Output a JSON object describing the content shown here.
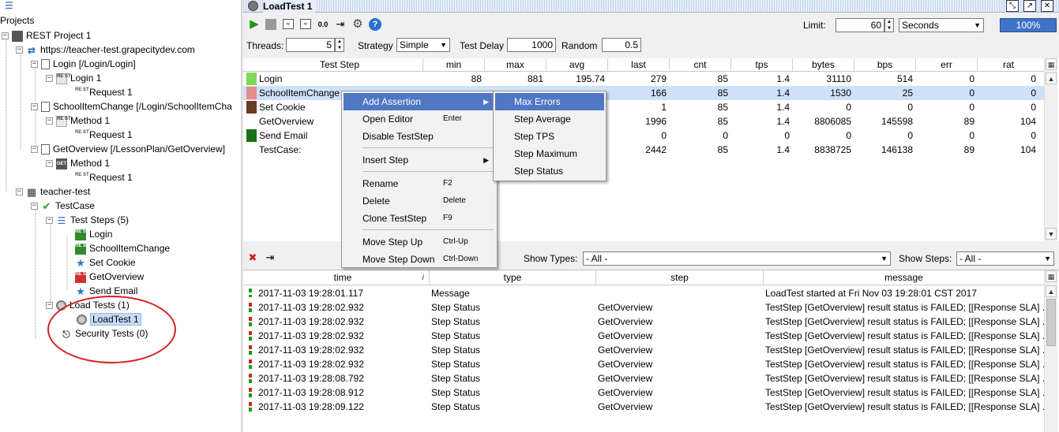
{
  "left": {
    "title": "Projects",
    "nodes": [
      {
        "label": "REST Project 1"
      },
      {
        "label": "https://teacher-test.grapecitydev.com"
      },
      {
        "label": "Login [/Login/Login]"
      },
      {
        "label": "Login 1"
      },
      {
        "label": "Request 1"
      },
      {
        "label": "SchoolItemChange [/Login/SchoolItemCha"
      },
      {
        "label": "Method 1"
      },
      {
        "label": "Request 1"
      },
      {
        "label": "GetOverview [/LessonPlan/GetOverview]"
      },
      {
        "label": "Method 1"
      },
      {
        "label": "Request 1"
      },
      {
        "label": "teacher-test"
      },
      {
        "label": "TestCase"
      },
      {
        "label": "Test Steps (5)"
      },
      {
        "label": "Login"
      },
      {
        "label": "SchoolItemChange"
      },
      {
        "label": "Set Cookie"
      },
      {
        "label": "GetOverview"
      },
      {
        "label": "Send Email"
      },
      {
        "label": "Load Tests (1)"
      },
      {
        "label": "LoadTest 1"
      },
      {
        "label": "Security Tests (0)"
      }
    ],
    "icon_badges": {
      "rest": "RE ST",
      "get": "GET"
    }
  },
  "window": {
    "title": "LoadTest 1",
    "controls": [
      "⤡",
      "↗",
      "✕"
    ]
  },
  "toolbar": {
    "num_icon": "0.0",
    "help_icon": "?",
    "limit_label": "Limit:",
    "limit_value": "60",
    "limit_unit": "Seconds",
    "progress": "100%",
    "progress_fraction": 1.0
  },
  "settings": {
    "threads_label": "Threads:",
    "threads_value": "5",
    "strategy_label": "Strategy",
    "strategy_value": "Simple",
    "delay_label": "Test Delay",
    "delay_value": "1000",
    "random_label": "Random",
    "random_value": "0.5"
  },
  "stats": {
    "headers": [
      "Test Step",
      "min",
      "max",
      "avg",
      "last",
      "cnt",
      "tps",
      "bytes",
      "bps",
      "err",
      "rat"
    ],
    "rows": [
      {
        "name": "Login",
        "color": "#7ed957",
        "cells": [
          "88",
          "881",
          "195.74",
          "279",
          "85",
          "1.4",
          "31110",
          "514",
          "0",
          "0"
        ]
      },
      {
        "name": "SchoolItemChange",
        "color": "#e88a8a",
        "cells": [
          "",
          "",
          "",
          "166",
          "85",
          "1.4",
          "1530",
          "25",
          "0",
          "0"
        ]
      },
      {
        "name": "Set Cookie",
        "color": "#6b3a22",
        "cells": [
          "",
          "",
          "",
          "1",
          "85",
          "1.4",
          "0",
          "0",
          "0",
          "0"
        ]
      },
      {
        "name": "GetOverview",
        "color": "",
        "cells": [
          "",
          "",
          "",
          "1996",
          "85",
          "1.4",
          "8806085",
          "145598",
          "89",
          "104"
        ]
      },
      {
        "name": "Send Email",
        "color": "#1a6e16",
        "cells": [
          "",
          "",
          "",
          "0",
          "0",
          "0",
          "0",
          "0",
          "0",
          "0"
        ]
      },
      {
        "name": "TestCase:",
        "color": "",
        "cells": [
          "",
          "",
          "",
          "2442",
          "85",
          "1.4",
          "8838725",
          "146138",
          "89",
          "104"
        ]
      }
    ]
  },
  "logbar": {
    "types_label": "Show Types:",
    "types_value": "- All -",
    "steps_label": "Show Steps:",
    "steps_value": "- All -"
  },
  "log": {
    "headers": [
      "time",
      "type",
      "step",
      "message"
    ],
    "sort_indicator": "/",
    "rows": [
      {
        "time": "2017-11-03 19:28:01.117",
        "type": "Message",
        "step": "",
        "message": "LoadTest started at Fri Nov 03 19:28:01 CST 2017",
        "mark": "info"
      },
      {
        "time": "2017-11-03 19:28:02.932",
        "type": "Step Status",
        "step": "GetOverview",
        "message": "TestStep [GetOverview] result status is FAILED; [[Response SLA] ...",
        "mark": "fail"
      },
      {
        "time": "2017-11-03 19:28:02.932",
        "type": "Step Status",
        "step": "GetOverview",
        "message": "TestStep [GetOverview] result status is FAILED; [[Response SLA] ...",
        "mark": "fail"
      },
      {
        "time": "2017-11-03 19:28:02.932",
        "type": "Step Status",
        "step": "GetOverview",
        "message": "TestStep [GetOverview] result status is FAILED; [[Response SLA] ...",
        "mark": "fail"
      },
      {
        "time": "2017-11-03 19:28:02.932",
        "type": "Step Status",
        "step": "GetOverview",
        "message": "TestStep [GetOverview] result status is FAILED; [[Response SLA] ...",
        "mark": "fail"
      },
      {
        "time": "2017-11-03 19:28:02.932",
        "type": "Step Status",
        "step": "GetOverview",
        "message": "TestStep [GetOverview] result status is FAILED; [[Response SLA] ...",
        "mark": "fail"
      },
      {
        "time": "2017-11-03 19:28:08.792",
        "type": "Step Status",
        "step": "GetOverview",
        "message": "TestStep [GetOverview] result status is FAILED; [[Response SLA] ...",
        "mark": "fail"
      },
      {
        "time": "2017-11-03 19:28:08.912",
        "type": "Step Status",
        "step": "GetOverview",
        "message": "TestStep [GetOverview] result status is FAILED; [[Response SLA] ...",
        "mark": "fail"
      },
      {
        "time": "2017-11-03 19:28:09.122",
        "type": "Step Status",
        "step": "GetOverview",
        "message": "TestStep [GetOverview] result status is FAILED; [[Response SLA] ...",
        "mark": "fail"
      }
    ]
  },
  "context_menu": {
    "items": [
      {
        "label": "Add Assertion",
        "shortcut": "",
        "submenu": true
      },
      {
        "label": "Open Editor",
        "shortcut": "Enter",
        "submenu": false
      },
      {
        "label": "Disable TestStep",
        "shortcut": "",
        "submenu": false
      },
      {
        "label": "Insert Step",
        "shortcut": "",
        "submenu": true
      },
      {
        "label": "Rename",
        "shortcut": "F2",
        "submenu": false
      },
      {
        "label": "Delete",
        "shortcut": "Delete",
        "submenu": false
      },
      {
        "label": "Clone TestStep",
        "shortcut": "F9",
        "submenu": false
      },
      {
        "label": "Move Step Up",
        "shortcut": "Ctrl-Up",
        "submenu": false
      },
      {
        "label": "Move Step Down",
        "shortcut": "Ctrl-Down",
        "submenu": false
      }
    ],
    "submenu_arrow": "▶"
  },
  "assertion_menu": {
    "items": [
      "Max Errors",
      "Step Average",
      "Step TPS",
      "Step Maximum",
      "Step Status"
    ]
  }
}
